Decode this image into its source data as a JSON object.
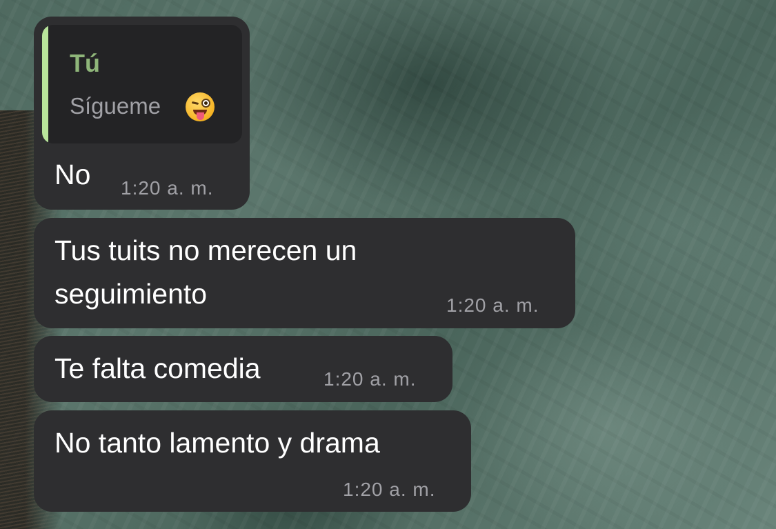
{
  "messages": [
    {
      "reply": {
        "sender": "Tú",
        "text": "Sígueme",
        "emoji": "winking-face-with-tongue"
      },
      "lines": [
        "No"
      ],
      "time": "1:20 a. m."
    },
    {
      "lines": [
        "Tus tuits no merecen un",
        "seguimiento"
      ],
      "time": "1:20 a. m."
    },
    {
      "lines": [
        "Te falta comedia"
      ],
      "time": "1:20 a. m."
    },
    {
      "lines": [
        "No tanto lamento y drama"
      ],
      "time": "1:20 a. m."
    }
  ],
  "theme": {
    "bubble_color": "#2e2e30",
    "quote_background": "#232325",
    "quote_accent": "#b8e49b",
    "quote_sender_color": "#8fb67a",
    "timestamp_color": "#a1a1a6",
    "text_color": "#ffffff"
  }
}
